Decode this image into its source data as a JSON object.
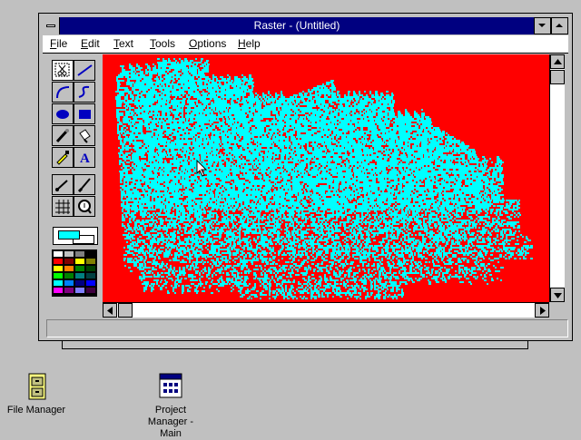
{
  "window": {
    "title": "Raster - (Untitled)",
    "menu": [
      {
        "label": "File",
        "underline": "F",
        "rest": "ile"
      },
      {
        "label": "Edit",
        "underline": "E",
        "rest": "dit"
      },
      {
        "label": "Text",
        "underline": "T",
        "rest": "ext"
      },
      {
        "label": "Tools",
        "underline": "T",
        "rest": "ools"
      },
      {
        "label": "Options",
        "underline": "O",
        "rest": "ptions"
      },
      {
        "label": "Help",
        "underline": "H",
        "rest": "elp"
      }
    ]
  },
  "toolbox": {
    "tools": [
      "scissors-select-icon",
      "line-icon",
      "curve-icon",
      "freehand-icon",
      "ellipse-icon",
      "rectangle-icon",
      "airbrush-icon",
      "paint-bucket-icon",
      "eyedropper-icon",
      "text-icon",
      "dropper-line-icon",
      "brush-icon",
      "grid-icon",
      "zoom-icon"
    ],
    "foreground_color": "#00ffff",
    "background_color": "#ffffff",
    "palette": [
      "#ffffff",
      "#c0c0c0",
      "#808080",
      "#000000",
      "#ff0000",
      "#800000",
      "#ffff00",
      "#808000",
      "#ffff00",
      "#ff8000",
      "#008000",
      "#004000",
      "#00ff00",
      "#008000",
      "#008080",
      "#004040",
      "#00ffff",
      "#0080ff",
      "#000080",
      "#0000ff",
      "#ff00ff",
      "#800080",
      "#8080ff",
      "#400040"
    ]
  },
  "canvas": {
    "fill_color": "#ff0000",
    "paint_color": "#00ffff"
  },
  "desktop": {
    "icons": [
      {
        "label": "File Manager"
      },
      {
        "label_lines": [
          "Project",
          "Manager -",
          "Main"
        ]
      }
    ]
  }
}
